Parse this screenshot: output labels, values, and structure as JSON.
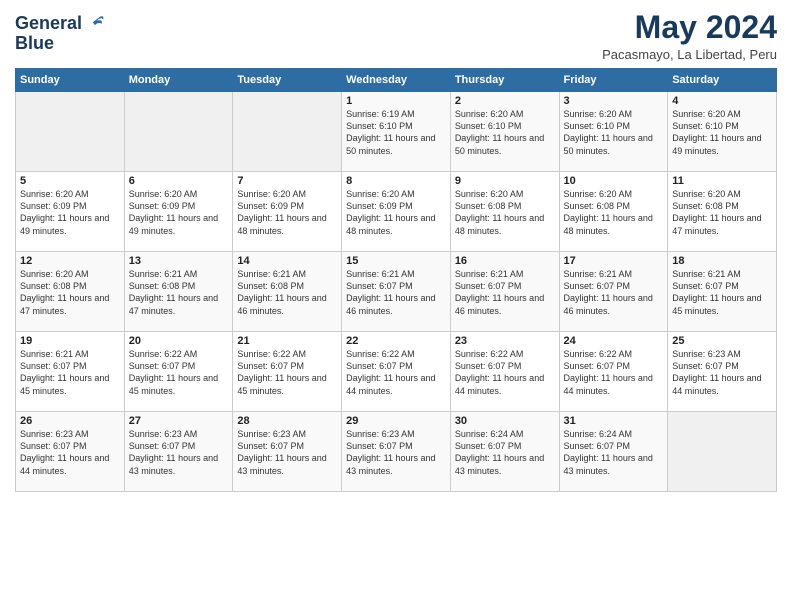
{
  "logo": {
    "line1": "General",
    "line2": "Blue"
  },
  "title": "May 2024",
  "subtitle": "Pacasmayo, La Libertad, Peru",
  "weekdays": [
    "Sunday",
    "Monday",
    "Tuesday",
    "Wednesday",
    "Thursday",
    "Friday",
    "Saturday"
  ],
  "weeks": [
    [
      {
        "day": "",
        "info": ""
      },
      {
        "day": "",
        "info": ""
      },
      {
        "day": "",
        "info": ""
      },
      {
        "day": "1",
        "info": "Sunrise: 6:19 AM\nSunset: 6:10 PM\nDaylight: 11 hours and 50 minutes."
      },
      {
        "day": "2",
        "info": "Sunrise: 6:20 AM\nSunset: 6:10 PM\nDaylight: 11 hours and 50 minutes."
      },
      {
        "day": "3",
        "info": "Sunrise: 6:20 AM\nSunset: 6:10 PM\nDaylight: 11 hours and 50 minutes."
      },
      {
        "day": "4",
        "info": "Sunrise: 6:20 AM\nSunset: 6:10 PM\nDaylight: 11 hours and 49 minutes."
      }
    ],
    [
      {
        "day": "5",
        "info": "Sunrise: 6:20 AM\nSunset: 6:09 PM\nDaylight: 11 hours and 49 minutes."
      },
      {
        "day": "6",
        "info": "Sunrise: 6:20 AM\nSunset: 6:09 PM\nDaylight: 11 hours and 49 minutes."
      },
      {
        "day": "7",
        "info": "Sunrise: 6:20 AM\nSunset: 6:09 PM\nDaylight: 11 hours and 48 minutes."
      },
      {
        "day": "8",
        "info": "Sunrise: 6:20 AM\nSunset: 6:09 PM\nDaylight: 11 hours and 48 minutes."
      },
      {
        "day": "9",
        "info": "Sunrise: 6:20 AM\nSunset: 6:08 PM\nDaylight: 11 hours and 48 minutes."
      },
      {
        "day": "10",
        "info": "Sunrise: 6:20 AM\nSunset: 6:08 PM\nDaylight: 11 hours and 48 minutes."
      },
      {
        "day": "11",
        "info": "Sunrise: 6:20 AM\nSunset: 6:08 PM\nDaylight: 11 hours and 47 minutes."
      }
    ],
    [
      {
        "day": "12",
        "info": "Sunrise: 6:20 AM\nSunset: 6:08 PM\nDaylight: 11 hours and 47 minutes."
      },
      {
        "day": "13",
        "info": "Sunrise: 6:21 AM\nSunset: 6:08 PM\nDaylight: 11 hours and 47 minutes."
      },
      {
        "day": "14",
        "info": "Sunrise: 6:21 AM\nSunset: 6:08 PM\nDaylight: 11 hours and 46 minutes."
      },
      {
        "day": "15",
        "info": "Sunrise: 6:21 AM\nSunset: 6:07 PM\nDaylight: 11 hours and 46 minutes."
      },
      {
        "day": "16",
        "info": "Sunrise: 6:21 AM\nSunset: 6:07 PM\nDaylight: 11 hours and 46 minutes."
      },
      {
        "day": "17",
        "info": "Sunrise: 6:21 AM\nSunset: 6:07 PM\nDaylight: 11 hours and 46 minutes."
      },
      {
        "day": "18",
        "info": "Sunrise: 6:21 AM\nSunset: 6:07 PM\nDaylight: 11 hours and 45 minutes."
      }
    ],
    [
      {
        "day": "19",
        "info": "Sunrise: 6:21 AM\nSunset: 6:07 PM\nDaylight: 11 hours and 45 minutes."
      },
      {
        "day": "20",
        "info": "Sunrise: 6:22 AM\nSunset: 6:07 PM\nDaylight: 11 hours and 45 minutes."
      },
      {
        "day": "21",
        "info": "Sunrise: 6:22 AM\nSunset: 6:07 PM\nDaylight: 11 hours and 45 minutes."
      },
      {
        "day": "22",
        "info": "Sunrise: 6:22 AM\nSunset: 6:07 PM\nDaylight: 11 hours and 44 minutes."
      },
      {
        "day": "23",
        "info": "Sunrise: 6:22 AM\nSunset: 6:07 PM\nDaylight: 11 hours and 44 minutes."
      },
      {
        "day": "24",
        "info": "Sunrise: 6:22 AM\nSunset: 6:07 PM\nDaylight: 11 hours and 44 minutes."
      },
      {
        "day": "25",
        "info": "Sunrise: 6:23 AM\nSunset: 6:07 PM\nDaylight: 11 hours and 44 minutes."
      }
    ],
    [
      {
        "day": "26",
        "info": "Sunrise: 6:23 AM\nSunset: 6:07 PM\nDaylight: 11 hours and 44 minutes."
      },
      {
        "day": "27",
        "info": "Sunrise: 6:23 AM\nSunset: 6:07 PM\nDaylight: 11 hours and 43 minutes."
      },
      {
        "day": "28",
        "info": "Sunrise: 6:23 AM\nSunset: 6:07 PM\nDaylight: 11 hours and 43 minutes."
      },
      {
        "day": "29",
        "info": "Sunrise: 6:23 AM\nSunset: 6:07 PM\nDaylight: 11 hours and 43 minutes."
      },
      {
        "day": "30",
        "info": "Sunrise: 6:24 AM\nSunset: 6:07 PM\nDaylight: 11 hours and 43 minutes."
      },
      {
        "day": "31",
        "info": "Sunrise: 6:24 AM\nSunset: 6:07 PM\nDaylight: 11 hours and 43 minutes."
      },
      {
        "day": "",
        "info": ""
      }
    ]
  ]
}
